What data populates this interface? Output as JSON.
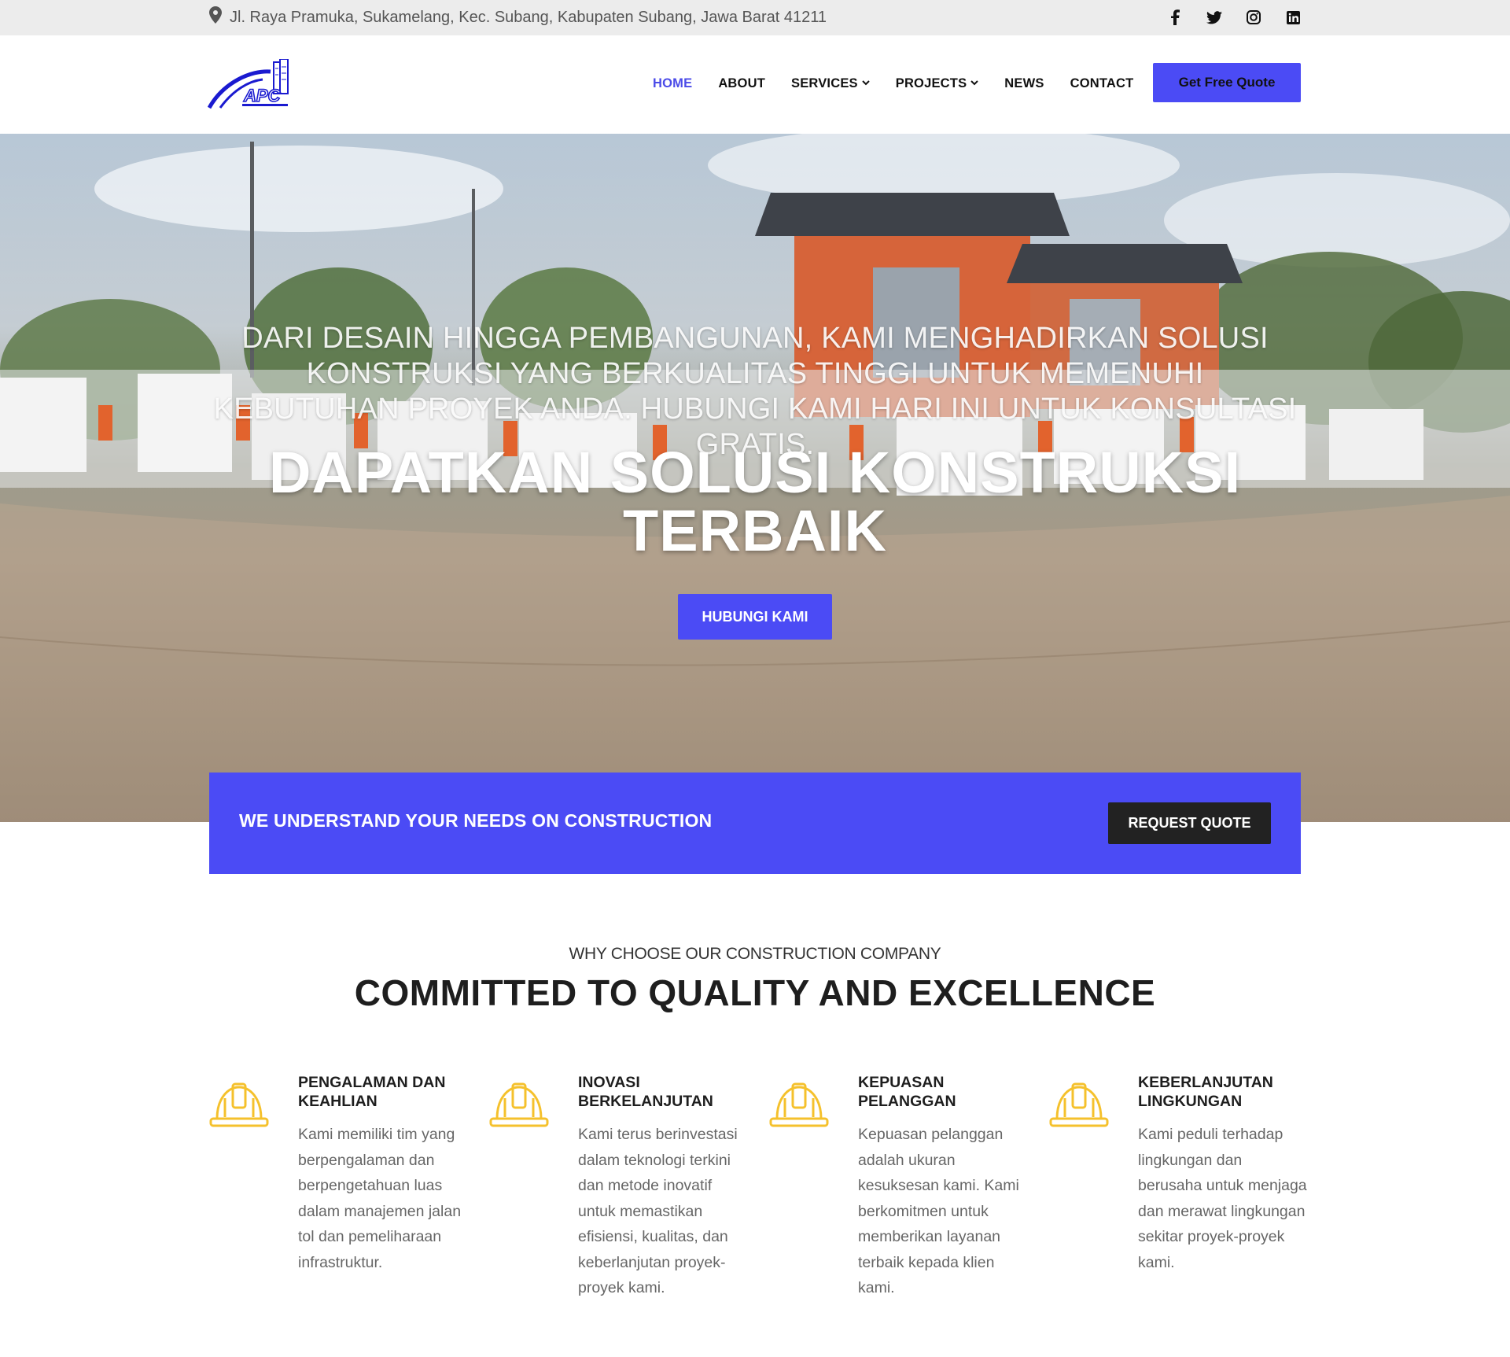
{
  "topbar": {
    "address": "Jl. Raya Pramuka, Sukamelang, Kec. Subang, Kabupaten Subang, Jawa Barat 41211",
    "social": [
      "facebook-icon",
      "twitter-icon",
      "instagram-icon",
      "linkedin-icon"
    ]
  },
  "header": {
    "logo_text": "APC",
    "nav": [
      {
        "label": "HOME",
        "active": true,
        "dropdown": false
      },
      {
        "label": "ABOUT",
        "active": false,
        "dropdown": false
      },
      {
        "label": "SERVICES",
        "active": false,
        "dropdown": true
      },
      {
        "label": "PROJECTS",
        "active": false,
        "dropdown": true
      },
      {
        "label": "NEWS",
        "active": false,
        "dropdown": false
      },
      {
        "label": "CONTACT",
        "active": false,
        "dropdown": false
      }
    ],
    "quote_button": "Get Free Quote"
  },
  "hero": {
    "subtitle": "DARI DESAIN HINGGA PEMBANGUNAN, KAMI MENGHADIRKAN SOLUSI KONSTRUKSI YANG BERKUALITAS TINGGI UNTUK MEMENUHI KEBUTUHAN PROYEK ANDA. HUBUNGI KAMI HARI INI UNTUK KONSULTASI GRATIS.",
    "title": "DAPATKAN SOLUSI KONSTRUKSI TERBAIK",
    "cta": "HUBUNGI KAMI"
  },
  "banner": {
    "text": "WE UNDERSTAND YOUR NEEDS ON CONSTRUCTION",
    "button": "REQUEST QUOTE"
  },
  "why": {
    "subtitle": "WHY CHOOSE OUR CONSTRUCTION COMPANY",
    "title": "COMMITTED TO QUALITY AND EXCELLENCE",
    "features": [
      {
        "title": "PENGALAMAN DAN KEAHLIAN",
        "text": "Kami memiliki tim yang berpengalaman dan berpengetahuan luas dalam manajemen jalan tol dan pemeliharaan infrastruktur.",
        "icon": "hard-hat-icon"
      },
      {
        "title": "INOVASI BERKELANJUTAN",
        "text": "Kami terus berinvestasi dalam teknologi terkini dan metode inovatif untuk memastikan efisiensi, kualitas, dan keberlanjutan proyek-proyek kami.",
        "icon": "hard-hat-icon"
      },
      {
        "title": "KEPUASAN PELANGGAN",
        "text": "Kepuasan pelanggan adalah ukuran kesuksesan kami. Kami berkomitmen untuk memberikan layanan terbaik kepada klien kami.",
        "icon": "hard-hat-icon"
      },
      {
        "title": "KEBERLANJUTAN LINGKUNGAN",
        "text": "Kami peduli terhadap lingkungan dan berusaha untuk menjaga dan merawat lingkungan sekitar proyek-proyek kami.",
        "icon": "hard-hat-icon"
      }
    ]
  },
  "colors": {
    "accent": "#4b4bf5",
    "nav_active": "#4b4be8",
    "icon_yellow": "#f5c12c",
    "dark_button": "#222222"
  }
}
